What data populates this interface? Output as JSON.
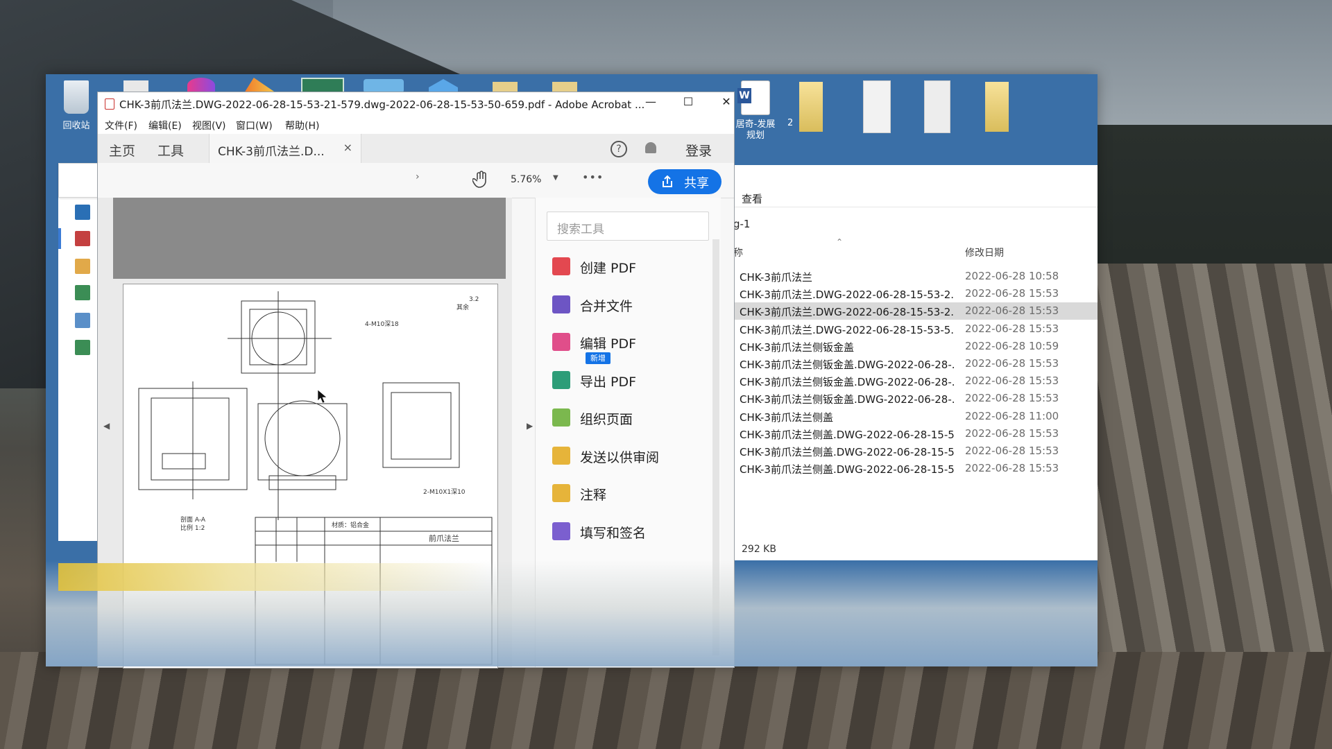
{
  "desktop": {
    "recycle_bin_label": "回收站",
    "word_doc_label_line1": "居奇-发展",
    "word_doc_label_line2": "规划",
    "word_doc_suffix": "2"
  },
  "acrobat": {
    "title": "CHK-3前爪法兰.DWG-2022-06-28-15-53-21-579.dwg-2022-06-28-15-53-50-659.pdf - Adobe Acrobat ...",
    "menu": [
      "文件(F)",
      "编辑(E)",
      "视图(V)",
      "窗口(W)",
      "帮助(H)"
    ],
    "tabs": {
      "home": "主页",
      "tools": "工具",
      "document": "CHK-3前爪法兰.D...",
      "close": "×"
    },
    "header_actions": {
      "help": "?",
      "login": "登录"
    },
    "toolbar": {
      "zoom": "5.76%",
      "more": "•••",
      "share": "共享"
    },
    "tool_search_placeholder": "搜索工具",
    "tools": [
      {
        "label": "创建 PDF",
        "color": "#e34850"
      },
      {
        "label": "合并文件",
        "color": "#6d55c4"
      },
      {
        "label": "编辑 PDF",
        "color": "#e04e8a"
      },
      {
        "label": "导出 PDF",
        "color": "#2d9d78"
      },
      {
        "label": "组织页面",
        "color": "#7bb84e"
      },
      {
        "label": "发送以供审阅",
        "color": "#e6b43a"
      },
      {
        "label": "注释",
        "color": "#e6b43a"
      },
      {
        "label": "填写和签名",
        "color": "#7b5fcf"
      }
    ],
    "new_badge": "新增",
    "drawing_texts": {
      "hole_note": "4-M10深18",
      "roughness": "3.2",
      "rest": "其余",
      "bottom_hole": "2-M10X1深10",
      "section": "剖面 A-A",
      "scale": "比例 1:2",
      "part_name": "前爪法兰",
      "material": "材质：铝合金"
    }
  },
  "explorer": {
    "ribbon_tab": "查看",
    "path": "g-1",
    "columns": {
      "name": "称",
      "modified": "修改日期"
    },
    "files": [
      {
        "name": "CHK-3前爪法兰",
        "date": "2022-06-28 10:58"
      },
      {
        "name": "CHK-3前爪法兰.DWG-2022-06-28-15-53-2...",
        "date": "2022-06-28 15:53"
      },
      {
        "name": "CHK-3前爪法兰.DWG-2022-06-28-15-53-2...",
        "date": "2022-06-28 15:53"
      },
      {
        "name": "CHK-3前爪法兰.DWG-2022-06-28-15-53-5...",
        "date": "2022-06-28 15:53"
      },
      {
        "name": "CHK-3前爪法兰侧钣金盖",
        "date": "2022-06-28 10:59"
      },
      {
        "name": "CHK-3前爪法兰侧钣金盖.DWG-2022-06-28-...",
        "date": "2022-06-28 15:53"
      },
      {
        "name": "CHK-3前爪法兰侧钣金盖.DWG-2022-06-28-...",
        "date": "2022-06-28 15:53"
      },
      {
        "name": "CHK-3前爪法兰侧钣金盖.DWG-2022-06-28-...",
        "date": "2022-06-28 15:53"
      },
      {
        "name": "CHK-3前爪法兰侧盖",
        "date": "2022-06-28 11:00"
      },
      {
        "name": "CHK-3前爪法兰侧盖.DWG-2022-06-28-15-5...",
        "date": "2022-06-28 15:53"
      },
      {
        "name": "CHK-3前爪法兰侧盖.DWG-2022-06-28-15-5...",
        "date": "2022-06-28 15:53"
      },
      {
        "name": "CHK-3前爪法兰侧盖.DWG-2022-06-28-15-5...",
        "date": "2022-06-28 15:53"
      }
    ],
    "selected_index": 2,
    "status_size": "292 KB"
  },
  "colors": {
    "accent": "#1473e6",
    "explorer_blue": "#3a6fa7"
  }
}
